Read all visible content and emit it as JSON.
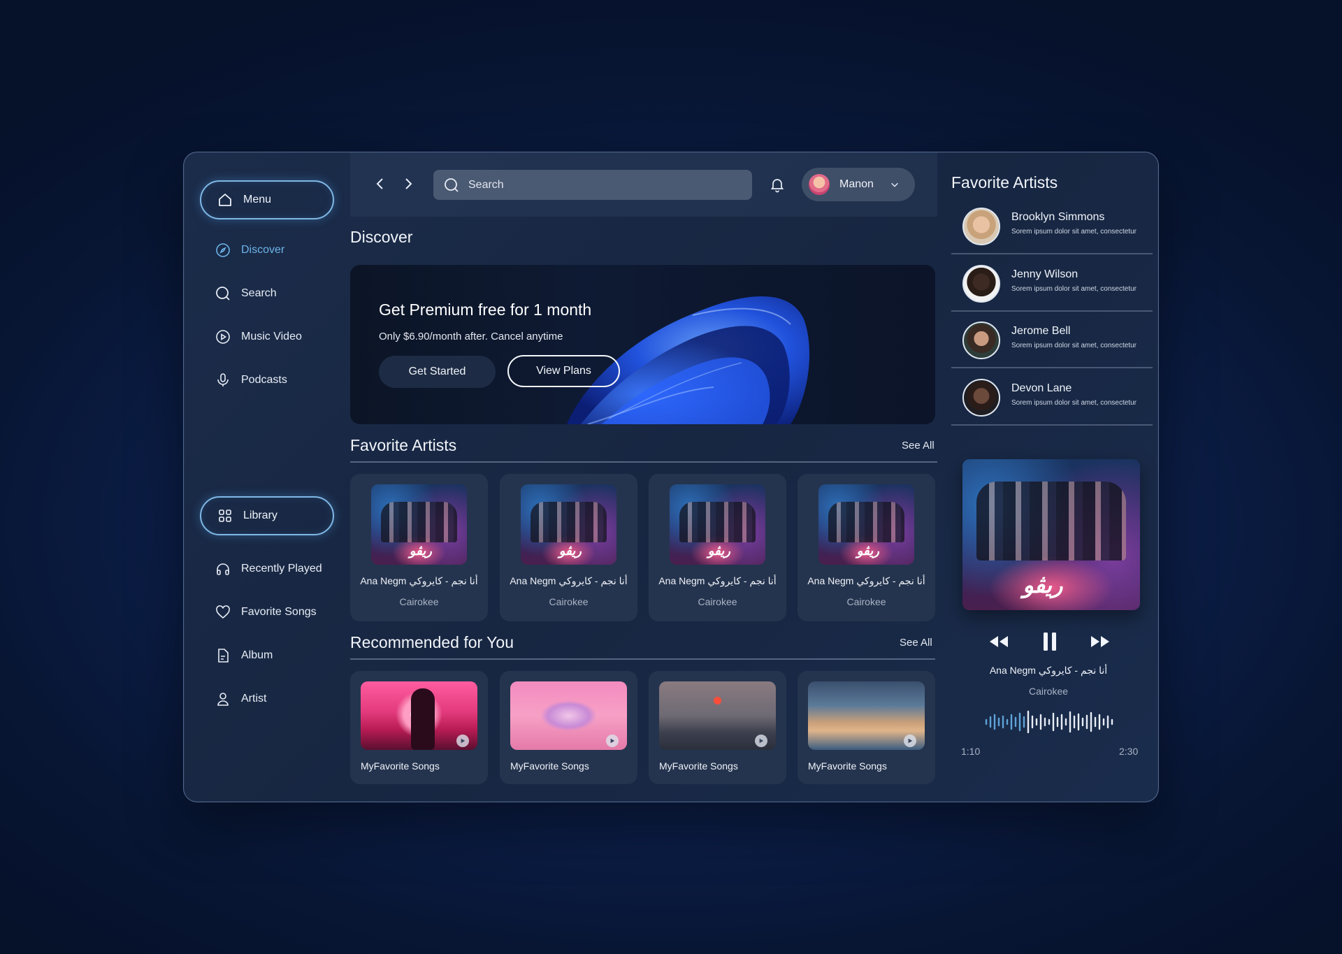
{
  "sidebar": {
    "menu_label": "Menu",
    "nav": [
      {
        "label": "Discover",
        "icon": "compass-icon",
        "active": true
      },
      {
        "label": "Search",
        "icon": "search-icon"
      },
      {
        "label": "Music Video",
        "icon": "play-circle-icon"
      },
      {
        "label": "Podcasts",
        "icon": "microphone-icon"
      }
    ],
    "library_label": "Library",
    "library_items": [
      {
        "label": "Recently Played",
        "icon": "headphones-icon"
      },
      {
        "label": "Favorite Songs",
        "icon": "heart-icon"
      },
      {
        "label": "Album",
        "icon": "document-icon"
      },
      {
        "label": "Artist",
        "icon": "user-icon"
      }
    ]
  },
  "topbar": {
    "search_placeholder": "Search",
    "user_name": "Manon"
  },
  "discover": {
    "title": "Discover",
    "banner": {
      "title": "Get Premium free for 1 month",
      "subtitle": "Only $6.90/month after. Cancel anytime",
      "primary_button": "Get Started",
      "secondary_button": "View Plans"
    }
  },
  "favorite_artists_section": {
    "title": "Favorite Artists",
    "see_all": "See All",
    "cards": [
      {
        "title": "Ana Negm أنا نجم - كايروكي",
        "artist": "Cairokee"
      },
      {
        "title": "Ana Negm أنا نجم - كايروكي",
        "artist": "Cairokee"
      },
      {
        "title": "Ana Negm أنا نجم - كايروكي",
        "artist": "Cairokee"
      },
      {
        "title": "Ana Negm أنا نجم - كايروكي",
        "artist": "Cairokee"
      }
    ]
  },
  "recommended": {
    "title": "Recommended for You",
    "see_all": "See All",
    "cards": [
      {
        "title": "MyFavorite Songs"
      },
      {
        "title": "MyFavorite Songs"
      },
      {
        "title": "MyFavorite Songs"
      },
      {
        "title": "MyFavorite Songs"
      }
    ]
  },
  "right_panel": {
    "title": "Favorite Artists",
    "artists": [
      {
        "name": "Brooklyn Simmons",
        "desc": "Sorem ipsum dolor sit amet, consectetur"
      },
      {
        "name": "Jenny Wilson",
        "desc": "Sorem ipsum dolor sit amet, consectetur"
      },
      {
        "name": "Jerome Bell",
        "desc": "Sorem ipsum dolor sit amet, consectetur"
      },
      {
        "name": "Devon Lane",
        "desc": "Sorem ipsum dolor sit amet, consectetur"
      }
    ],
    "now_playing": {
      "title": "Ana Negm أنا نجم - كايروكي",
      "artist": "Cairokee",
      "elapsed": "1:10",
      "duration": "2:30"
    }
  },
  "colors": {
    "accent": "#6db4e8",
    "panel": "#25344e",
    "background": "#0d2150"
  }
}
